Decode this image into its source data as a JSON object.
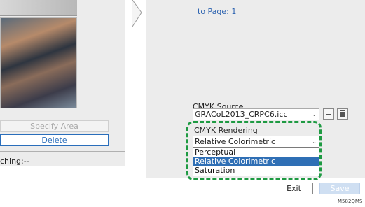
{
  "left_panel": {
    "specify_area_label": "Specify Area",
    "delete_label": "Delete",
    "matching_label": "ching:--"
  },
  "main": {
    "to_page_label": "to Page:  1",
    "cmyk_source": {
      "label": "CMYK Source",
      "value": "GRACoL2013_CRPC6.icc"
    },
    "cmyk_rendering": {
      "label": "CMYK Rendering",
      "value": "Relative Colorimetric",
      "options": [
        "Perceptual",
        "Relative Colorimetric",
        "Saturation"
      ],
      "highlight_color": "#1e9a42"
    }
  },
  "footer": {
    "exit_label": "Exit",
    "save_label": "Save",
    "figure_code": "M582QMS"
  },
  "icons": [
    "add-icon",
    "trash-icon",
    "chevron-down-icon"
  ]
}
